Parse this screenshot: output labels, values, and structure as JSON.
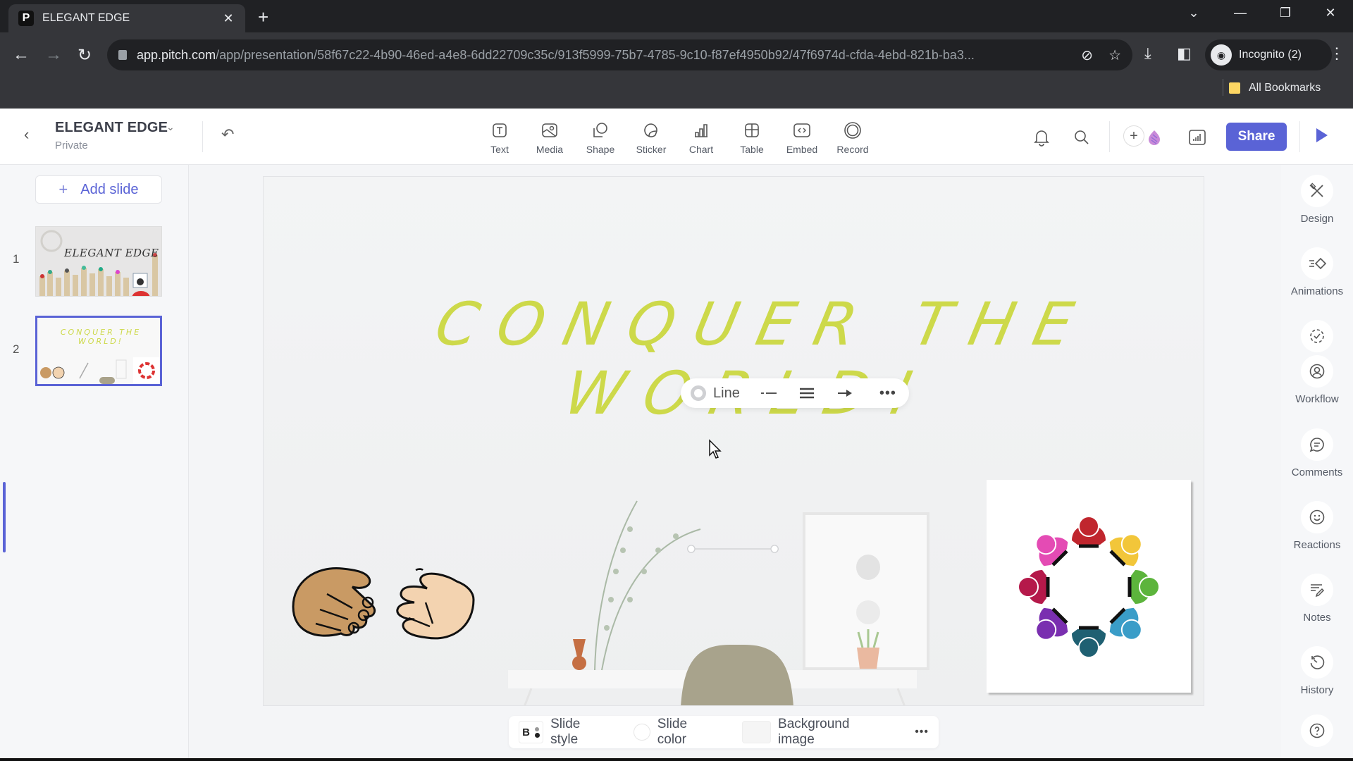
{
  "browser": {
    "tab_title": "ELEGANT EDGE",
    "tab_favicon": "P",
    "url_host": "app.pitch.com",
    "url_path": "/app/presentation/58f67c22-4b90-46ed-a4e8-6dd22709c35c/913f5999-75b7-4785-9c10-f87ef4950b92/47f6974d-cfda-4ebd-821b-ba3...",
    "profile_label": "Incognito (2)",
    "bookmarks_label": "All Bookmarks"
  },
  "app": {
    "doc_title": "ELEGANT EDGE",
    "doc_visibility": "Private",
    "tools": [
      {
        "label": "Text",
        "icon": "text-icon"
      },
      {
        "label": "Media",
        "icon": "media-icon"
      },
      {
        "label": "Shape",
        "icon": "shape-icon"
      },
      {
        "label": "Sticker",
        "icon": "sticker-icon"
      },
      {
        "label": "Chart",
        "icon": "chart-icon"
      },
      {
        "label": "Table",
        "icon": "table-icon"
      },
      {
        "label": "Embed",
        "icon": "embed-icon"
      },
      {
        "label": "Record",
        "icon": "record-icon"
      }
    ],
    "share_label": "Share",
    "accent_color": "#5a63d6"
  },
  "sidebar": {
    "add_slide_label": "Add slide",
    "slides": [
      {
        "number": "1",
        "title": "ELEGANT EDGE"
      },
      {
        "number": "2",
        "title": "CONQUER THE WORLD!",
        "selected": true
      }
    ]
  },
  "right_panel": {
    "items": [
      {
        "label": "Design",
        "icon": "design-icon"
      },
      {
        "label": "Animations",
        "icon": "animations-icon"
      },
      {
        "label": "Workflow",
        "icon": "workflow-icon"
      },
      {
        "label": "Comments",
        "icon": "comments-icon"
      },
      {
        "label": "Reactions",
        "icon": "reactions-icon"
      },
      {
        "label": "Notes",
        "icon": "notes-icon"
      },
      {
        "label": "History",
        "icon": "history-icon"
      }
    ]
  },
  "slide": {
    "title": "CONQUER THE WORLD!",
    "title_color": "#cdd94a"
  },
  "line_toolbar": {
    "type_label": "Line"
  },
  "bottom_bar": {
    "slide_style_badge": "B",
    "slide_style_label": "Slide style",
    "slide_color_label": "Slide color",
    "background_image_label": "Background image"
  }
}
